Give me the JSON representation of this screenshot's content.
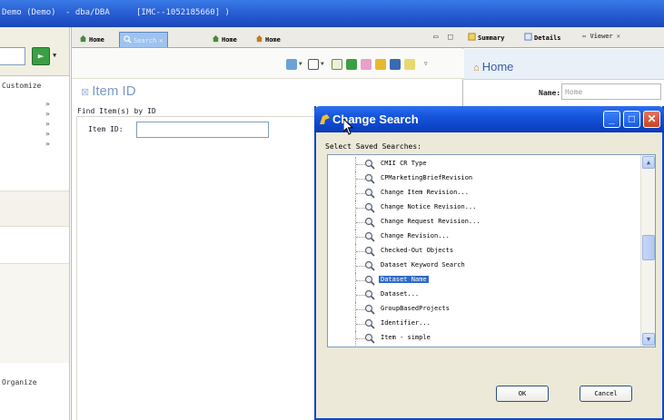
{
  "titlebar": {
    "segments": [
      "Demo (Demo)",
      "- dba/DBA",
      "[IMC--1052185660] )"
    ]
  },
  "left_panel": {
    "go_icon": "green-arrow-icon",
    "customize_label": "Customize",
    "organize_label": "Organize",
    "bullets": [
      "»",
      "»",
      "»",
      "»",
      "»"
    ]
  },
  "center_panel": {
    "tabs": [
      {
        "label": "Home",
        "icon": "home-icon",
        "active": false
      },
      {
        "label": "Search",
        "icon": "search-icon",
        "active": true
      },
      {
        "label": "Home",
        "icon": "home-icon",
        "active": false
      },
      {
        "label": "Home",
        "icon": "home-icon",
        "active": false
      }
    ],
    "header": "Item ID",
    "find_label": "Find Item(s) by ID",
    "item_id_label": "Item ID:",
    "item_id_value": ""
  },
  "right_panel": {
    "tabs": [
      "Summary",
      "Details",
      "Viewer"
    ],
    "home_title": "Home",
    "name_label": "Name:",
    "name_value": "Home"
  },
  "dialog": {
    "title": "Change Search",
    "list_label": "Select Saved Searches:",
    "items": [
      {
        "label": "CMII CR Type",
        "selected": false
      },
      {
        "label": "CPMarketingBriefRevision",
        "selected": false
      },
      {
        "label": "Change Item Revision...",
        "selected": false
      },
      {
        "label": "Change Notice Revision...",
        "selected": false
      },
      {
        "label": "Change Request Revision...",
        "selected": false
      },
      {
        "label": "Change Revision...",
        "selected": false
      },
      {
        "label": "Checked-Out Objects",
        "selected": false
      },
      {
        "label": "Dataset Keyword Search",
        "selected": false
      },
      {
        "label": "Dataset Name",
        "selected": true
      },
      {
        "label": "Dataset...",
        "selected": false
      },
      {
        "label": "GroupBasedProjects",
        "selected": false
      },
      {
        "label": "Identifier...",
        "selected": false
      },
      {
        "label": "Item - simple",
        "selected": false
      }
    ],
    "ok_label": "OK",
    "cancel_label": "Cancel",
    "minimize_glyph": "_",
    "maximize_glyph": "□",
    "close_glyph": "✕"
  }
}
